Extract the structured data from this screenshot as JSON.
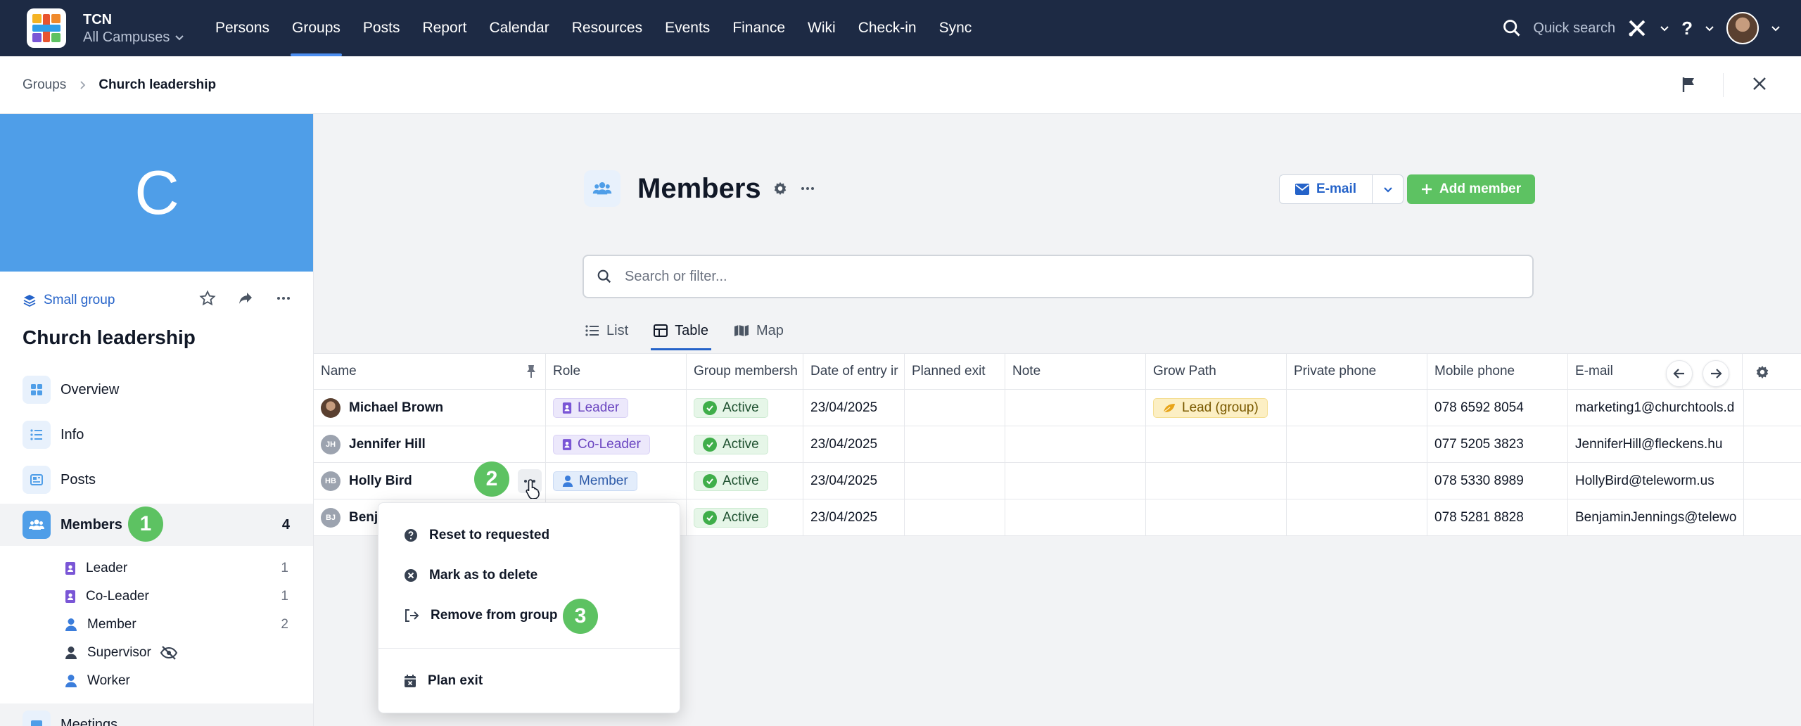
{
  "header": {
    "org_name": "TCN",
    "campus": "All Campuses",
    "nav": [
      "Persons",
      "Groups",
      "Posts",
      "Report",
      "Calendar",
      "Resources",
      "Events",
      "Finance",
      "Wiki",
      "Check-in",
      "Sync"
    ],
    "active_nav": "Groups",
    "quick_search": "Quick search",
    "help": "?"
  },
  "breadcrumb": {
    "parent": "Groups",
    "current": "Church leadership"
  },
  "sidebar": {
    "banner_letter": "C",
    "group_type": "Small group",
    "group_name": "Church leadership",
    "menu": [
      {
        "label": "Overview"
      },
      {
        "label": "Info"
      },
      {
        "label": "Posts"
      },
      {
        "label": "Members",
        "count": "4"
      },
      {
        "label": "Meetings"
      }
    ],
    "roles": [
      {
        "label": "Leader",
        "count": "1"
      },
      {
        "label": "Co-Leader",
        "count": "1"
      },
      {
        "label": "Member",
        "count": "2"
      },
      {
        "label": "Supervisor",
        "count": ""
      },
      {
        "label": "Worker",
        "count": ""
      }
    ]
  },
  "main": {
    "title": "Members",
    "email_label": "E-mail",
    "add_member_label": "Add member",
    "search_placeholder": "Search or filter...",
    "views": [
      "List",
      "Table",
      "Map"
    ],
    "active_view": "Table"
  },
  "table": {
    "columns": [
      "Name",
      "Role",
      "Group membersh",
      "Date of entry ir",
      "Planned exit",
      "Note",
      "Grow Path",
      "Private phone",
      "Mobile phone",
      "E-mail"
    ],
    "rows": [
      {
        "initials": "",
        "name": "Michael Brown",
        "role": "Leader",
        "status": "Active",
        "date": "23/04/2025",
        "grow_path": "Lead (group)",
        "mobile": "078 6592 8054",
        "email": "marketing1@churchtools.d"
      },
      {
        "initials": "JH",
        "name": "Jennifer Hill",
        "role": "Co-Leader",
        "status": "Active",
        "date": "23/04/2025",
        "grow_path": "",
        "mobile": "077 5205 3823",
        "email": "JenniferHill@fleckens.hu"
      },
      {
        "initials": "HB",
        "name": "Holly Bird",
        "role": "Member",
        "status": "Active",
        "date": "23/04/2025",
        "grow_path": "",
        "mobile": "078 5330 8989",
        "email": "HollyBird@teleworm.us"
      },
      {
        "initials": "BJ",
        "name": "Benj",
        "role": "",
        "status": "Active",
        "date": "23/04/2025",
        "grow_path": "",
        "mobile": "078 5281 8828",
        "email": "BenjaminJennings@telewo"
      }
    ]
  },
  "context_menu": {
    "items": [
      "Reset to requested",
      "Mark as to delete",
      "Remove from group",
      "Plan exit"
    ]
  },
  "steps": [
    "1",
    "2",
    "3"
  ],
  "colors": {
    "nav_bg": "#1d2a44",
    "accent": "#2563c9",
    "green": "#5dc262",
    "banner": "#4f9ee8"
  }
}
